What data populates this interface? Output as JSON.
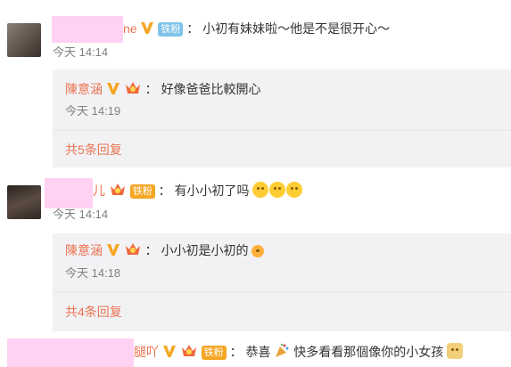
{
  "comments": [
    {
      "name_tail": "ne",
      "fan_badge": "铁粉",
      "text": "小初有妹妹啦～他是不是很开心～",
      "time": "今天 14:14",
      "reply": {
        "name": "陳意涵",
        "text": "好像爸爸比較開心",
        "time": "今天 14:19"
      },
      "more_label": "共5条回复"
    },
    {
      "name_tail": "儿",
      "fan_badge": "铁粉",
      "text": "有小小初了吗",
      "time": "今天 14:14",
      "reply": {
        "name": "陳意涵",
        "text": "小小初是小初的",
        "time": "今天 14:18"
      },
      "more_label": "共4条回复"
    },
    {
      "name_tail": "腿吖",
      "fan_badge": "铁粉",
      "text_a": "恭喜",
      "text_b": "快多看看那個像你的小女孩",
      "time": ""
    }
  ],
  "colon": "：",
  "icons": {
    "vip": "vip-v-icon",
    "crown": "crown-badge-icon",
    "emoji": "emoji-icon",
    "party": "party-popper-icon"
  },
  "colors": {
    "name": "#eb7350",
    "time": "#808080",
    "reply_bg": "#f2f2f5",
    "fan_blue": "#7fc3e8",
    "fan_gold": "#f5a623"
  }
}
